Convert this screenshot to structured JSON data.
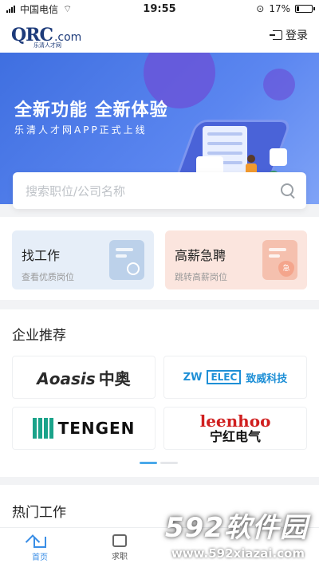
{
  "status_bar": {
    "carrier": "中国电信",
    "time": "19:55",
    "battery": "17%",
    "battery_level": 0.17
  },
  "header": {
    "logo_main": "QRC",
    "logo_domain": ".com",
    "logo_sub": "乐清人才网",
    "login_label": "登录"
  },
  "banner": {
    "title": "全新功能  全新体验",
    "subtitle": "乐清人才网APP正式上线"
  },
  "search": {
    "placeholder": "搜索职位/公司名称"
  },
  "quick_links": [
    {
      "title": "找工作",
      "desc": "查看优质岗位"
    },
    {
      "title": "高薪急聘",
      "desc": "跳转高薪岗位",
      "badge": "急"
    }
  ],
  "companies_section": {
    "title": "企业推荐",
    "companies": [
      {
        "logo_en": "Aoasis",
        "logo_cn": "中奥"
      },
      {
        "logo_en": "ZW",
        "logo_box": "ELEC",
        "logo_cn": "致威科技"
      },
      {
        "logo_en": "TENGEN"
      },
      {
        "logo_en": "leenhoo",
        "logo_cn": "宁红电气"
      }
    ],
    "pager": {
      "count": 2,
      "active": 0
    }
  },
  "hot_jobs": {
    "title": "热门工作"
  },
  "tabbar": {
    "tabs": [
      {
        "label": "首页",
        "active": true
      },
      {
        "label": "求职",
        "active": false
      }
    ]
  },
  "watermark": {
    "main": "592软件园",
    "url": "www.592xiazai.com"
  }
}
